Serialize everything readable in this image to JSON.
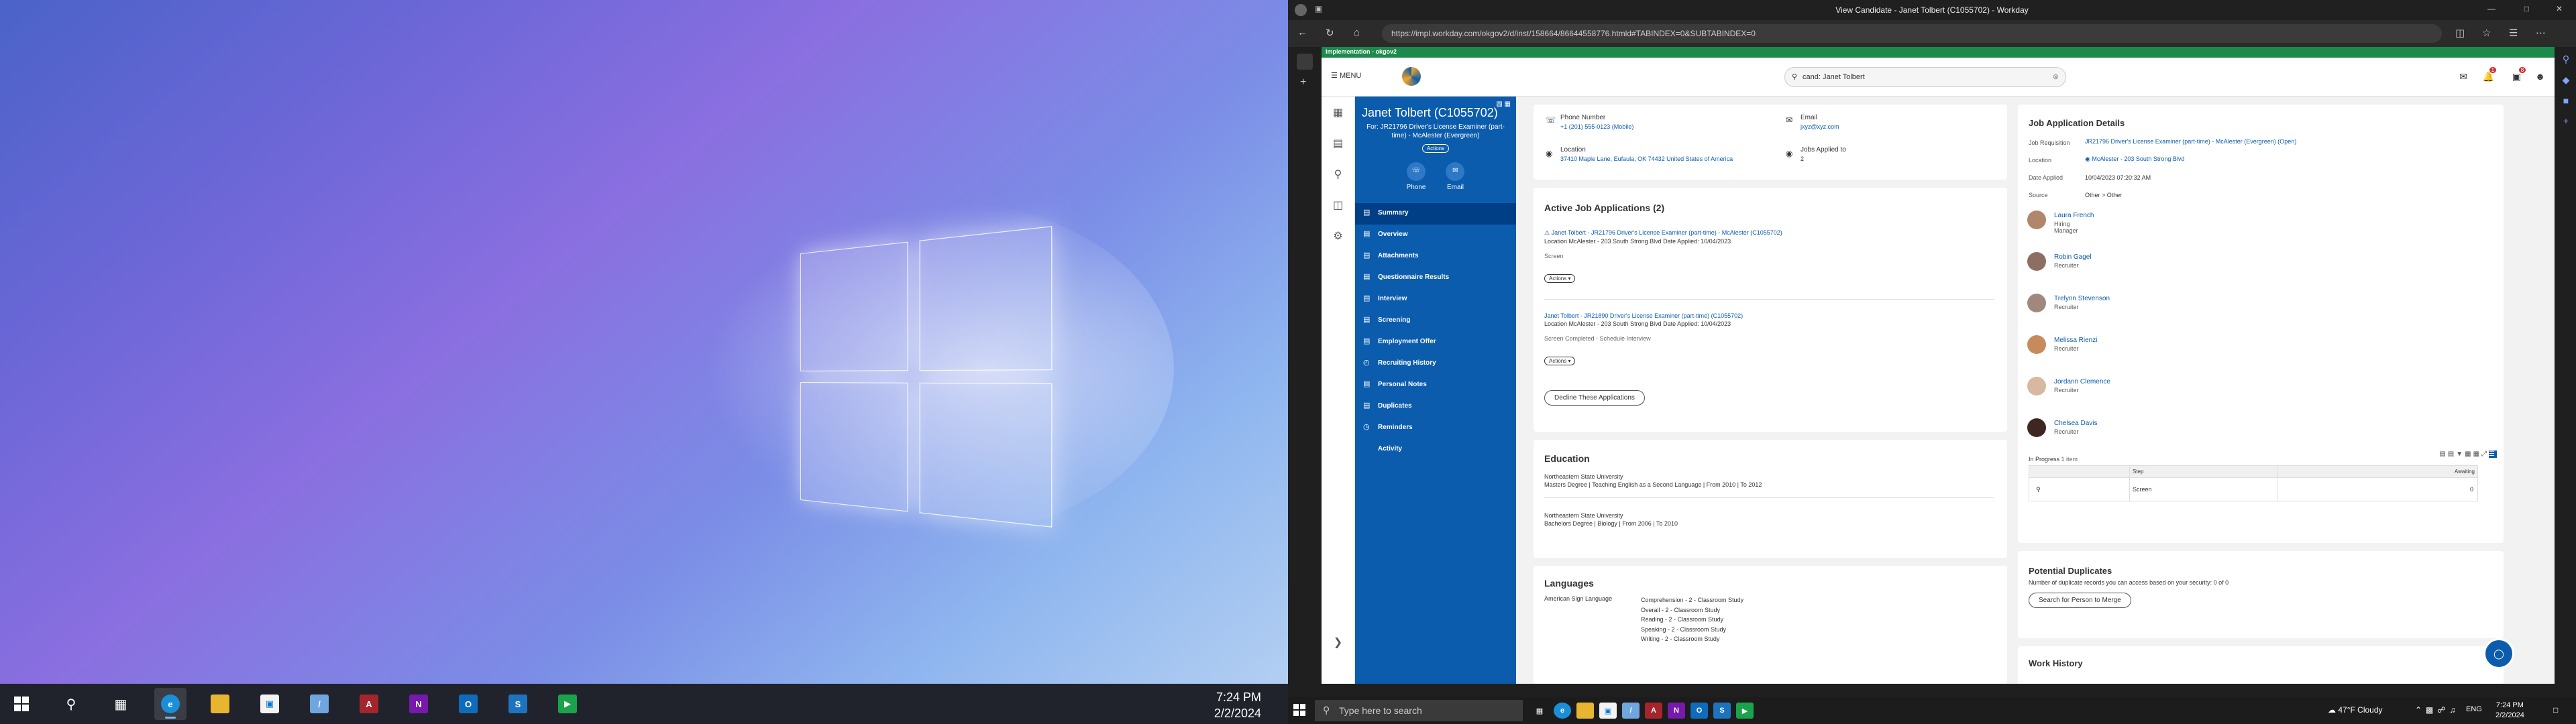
{
  "taskbar_left": {
    "time": "7:24 PM",
    "date": "2/2/2024"
  },
  "browser": {
    "title": "View Candidate - Janet Tolbert (C1055702) - Workday",
    "url": "https://impl.workday.com/okgov2/d/inst/158664/86644558776.htmld#TABINDEX=0&SUBTABINDEX=0"
  },
  "workday": {
    "banner": "Implementation - okgov2",
    "menu_label": "MENU",
    "search_value": "cand: Janet Tolbert",
    "notifications_count": "1",
    "inbox_count": "8",
    "candidate": {
      "name": "Janet Tolbert (C1055702)",
      "requisition": "For: JR21796 Driver's License Examiner (part-time) - McAlester (Evergreen)",
      "actions": "Actions",
      "phone_label": "Phone",
      "email_label": "Email"
    },
    "nav": [
      {
        "label": "Summary",
        "icon": "summary-icon"
      },
      {
        "label": "Overview",
        "icon": "overview-icon"
      },
      {
        "label": "Attachments",
        "icon": "attachment-icon"
      },
      {
        "label": "Questionnaire Results",
        "icon": "questionnaire-icon"
      },
      {
        "label": "Interview",
        "icon": "interview-icon"
      },
      {
        "label": "Screening",
        "icon": "screening-icon"
      },
      {
        "label": "Employment Offer",
        "icon": "offer-icon"
      },
      {
        "label": "Recruiting History",
        "icon": "history-icon"
      },
      {
        "label": "Personal Notes",
        "icon": "notes-icon"
      },
      {
        "label": "Duplicates",
        "icon": "duplicates-icon"
      },
      {
        "label": "Reminders",
        "icon": "reminder-icon"
      },
      {
        "label": "Activity",
        "icon": "activity-icon"
      }
    ],
    "contact": {
      "phone_label": "Phone Number",
      "phone_value": "+1 (201) 555-0123 (Mobile)",
      "email_label": "Email",
      "email_value": "jxyz@xyz.com",
      "location_label": "Location",
      "location_value": "37410 Maple Lane, Eufaula, OK 74432 United States of America",
      "jobs_label": "Jobs Applied to",
      "jobs_value": "2"
    },
    "active_apps": {
      "title": "Active Job Applications (2)",
      "apps": [
        {
          "link": "Janet Tolbert - JR21796 Driver's License Examiner (part-time) - McAlester (C1055702)",
          "location": "Location McAlester - 203 South Strong Blvd  Date Applied: 10/04/2023",
          "status": "Screen",
          "actions": "Actions"
        },
        {
          "link": "Janet Tolbert - JR21890 Driver's License Examiner (part-time) (C1055702)",
          "location": "Location McAlester - 203 South Strong Blvd  Date Applied: 10/04/2023",
          "status": "Screen Completed - Schedule Interview",
          "actions": "Actions"
        }
      ],
      "decline_button": "Decline These Applications"
    },
    "education": {
      "title": "Education",
      "entries": [
        {
          "school": "Northeastern State University",
          "detail": "Masters Degree | Teaching English as a Second Language | From 2010 | To 2012"
        },
        {
          "school": "Northeastern State University",
          "detail": "Bachelors Degree | Biology | From 2006 | To 2010"
        }
      ]
    },
    "languages": {
      "title": "Languages",
      "language": "American Sign Language",
      "skills": [
        "Comprehension - 2 - Classroom Study",
        "Overall - 2 - Classroom Study",
        "Reading - 2 - Classroom Study",
        "Speaking - 2 - Classroom Study",
        "Writing - 2 - Classroom Study"
      ]
    },
    "job_details": {
      "title": "Job Application Details",
      "rows": [
        {
          "label": "Job Requisition",
          "value": "JR21796 Driver's License Examiner (part-time) - McAlester (Evergreen) (Open)"
        },
        {
          "label": "Location",
          "value": "McAlester - 203 South Strong Blvd"
        },
        {
          "label": "Date Applied",
          "value": "10/04/2023 07:20:32 AM"
        },
        {
          "label": "Source",
          "value": "Other > Other"
        }
      ],
      "people": [
        {
          "name": "Laura French",
          "role": "Hiring Manager"
        },
        {
          "name": "Robin Gagel",
          "role": "Recruiter"
        },
        {
          "name": "Trelynn Stevenson",
          "role": "Recruiter"
        },
        {
          "name": "Melissa Rienzi",
          "role": "Recruiter"
        },
        {
          "name": "Jordann Clemence",
          "role": "Recruiter"
        },
        {
          "name": "Chelsea Davis",
          "role": "Recruiter"
        }
      ],
      "in_progress_label": "In Progress",
      "in_progress_count": "1 item",
      "table_headers": [
        "Step",
        "Awaiting"
      ],
      "table_row": {
        "step": "Screen",
        "awaiting": "0"
      }
    },
    "duplicates": {
      "title": "Potential Duplicates",
      "text": "Number of duplicate records you can access based on your security: 0 of 0",
      "button": "Search for Person to Merge"
    },
    "work_history_title": "Work History"
  },
  "taskbar_right": {
    "search_placeholder": "Type here to search",
    "weather": "47°F  Cloudy",
    "lang": "ENG",
    "time": "7:24 PM",
    "date": "2/2/2024"
  },
  "colors": {
    "workday_blue": "#0b5cad",
    "banner_green": "#1b8a4a"
  }
}
